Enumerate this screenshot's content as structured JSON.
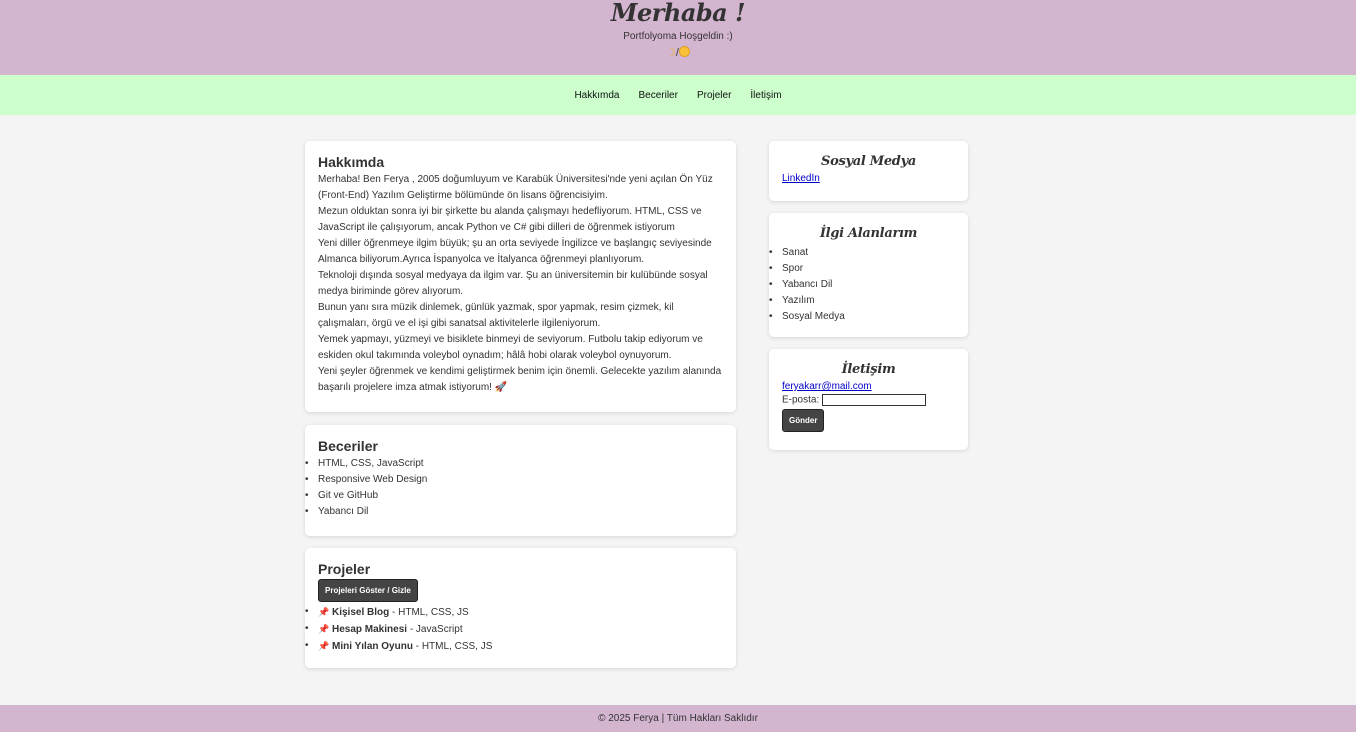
{
  "header": {
    "title": "Merhaba !",
    "subtitle": "Portfolyoma Hoşgeldin :)",
    "theme_separator": "/"
  },
  "nav": {
    "items": [
      {
        "label": "Hakkımda"
      },
      {
        "label": "Beceriler"
      },
      {
        "label": "Projeler"
      },
      {
        "label": "İletişim"
      }
    ]
  },
  "about": {
    "heading": "Hakkımda",
    "paragraphs": [
      "Merhaba! Ben Ferya , 2005 doğumluyum ve Karabük Üniversitesi'nde yeni açılan Ön Yüz (Front-End) Yazılım Geliştirme bölümünde ön lisans öğrencisiyim.",
      "Mezun olduktan sonra iyi bir şirkette bu alanda çalışmayı hedefliyorum. HTML, CSS ve JavaScript ile çalışıyorum, ancak Python ve C# gibi dilleri de öğrenmek istiyorum",
      "Yeni diller öğrenmeye ilgim büyük; şu an orta seviyede İngilizce ve başlangıç seviyesinde Almanca biliyorum.Ayrıca İspanyolca ve İtalyanca öğrenmeyi planlıyorum.",
      "Teknoloji dışında sosyal medyaya da ilgim var. Şu an üniversitemin bir kulübünde sosyal medya biriminde görev alıyorum.",
      "Bunun yanı sıra müzik dinlemek, günlük yazmak, spor yapmak, resim çizmek, kil çalışmaları, örgü ve el işi gibi sanatsal aktivitelerle ilgileniyorum.",
      "Yemek yapmayı, yüzmeyi ve bisiklete binmeyi de seviyorum. Futbolu takip ediyorum ve eskiden okul takımında voleybol oynadım; hâlâ hobi olarak voleybol oynuyorum.",
      "Yeni şeyler öğrenmek ve kendimi geliştirmek benim için önemli. Gelecekte yazılım alanında başarılı projelere imza atmak istiyorum! 🚀"
    ]
  },
  "skills": {
    "heading": "Beceriler",
    "items": [
      "HTML, CSS, JavaScript",
      "Responsive Web Design",
      "Git ve GitHub",
      "Yabancı Dil"
    ]
  },
  "projects": {
    "heading": "Projeler",
    "toggle_label": "Projeleri Göster / Gizle",
    "items": [
      {
        "icon": "pin-icon",
        "name": "Kişisel Blog",
        "tech": " - HTML, CSS, JS"
      },
      {
        "icon": "pin-icon",
        "name": "Hesap Makinesi",
        "tech": " - JavaScript"
      },
      {
        "icon": "pin-icon",
        "name": "Mini Yılan Oyunu",
        "tech": " - HTML, CSS, JS"
      }
    ]
  },
  "social": {
    "heading": "Sosyal Medya",
    "link": "LinkedIn"
  },
  "interests": {
    "heading": "İlgi Alanlarım",
    "items": [
      "Sanat",
      "Spor",
      "Yabancı Dil",
      "Yazılım",
      "Sosyal Medya"
    ]
  },
  "contact": {
    "heading": "İletişim",
    "email_link": "feryakarr@mail.com",
    "email_label": "E-posta:",
    "email_value": "",
    "submit_label": "Gönder"
  },
  "footer": {
    "text": "© 2025 Ferya | Tüm Hakları Saklıdır"
  },
  "colors": {
    "header_bg": "#d3b5d0",
    "nav_bg": "#ccffcc",
    "page_bg": "#f4f4f4",
    "button_bg": "#444444"
  }
}
